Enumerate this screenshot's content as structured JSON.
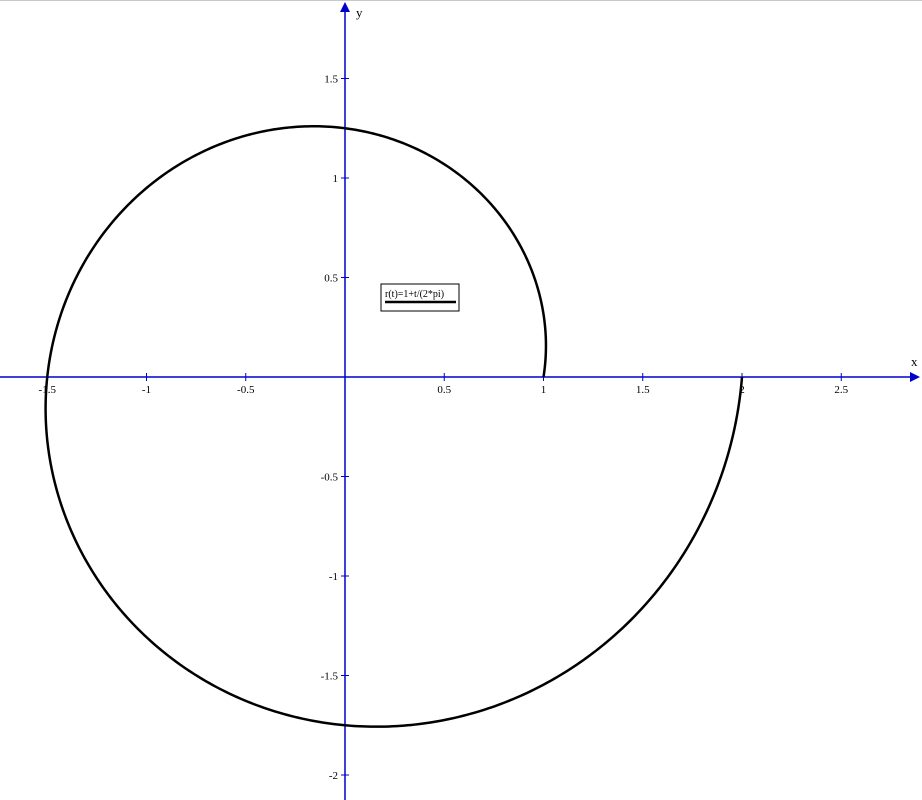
{
  "chart_data": {
    "type": "line",
    "plot_kind": "polar",
    "equation": "r(t)=1+t/(2*pi)",
    "t_range": [
      0,
      6.283185307179586
    ],
    "xlabel": "x",
    "ylabel": "y",
    "xlim": [
      -1.73,
      2.9
    ],
    "ylim": [
      -2.12,
      1.9
    ],
    "x_ticks": [
      {
        "value": -1.5,
        "label": "-1.5"
      },
      {
        "value": -1,
        "label": "-1"
      },
      {
        "value": -0.5,
        "label": "-0.5"
      },
      {
        "value": 0.5,
        "label": "0.5"
      },
      {
        "value": 1,
        "label": "1"
      },
      {
        "value": 1.5,
        "label": "1.5"
      },
      {
        "value": 2,
        "label": "2"
      },
      {
        "value": 2.5,
        "label": "2.5"
      }
    ],
    "y_ticks": [
      {
        "value": 1.5,
        "label": "1.5"
      },
      {
        "value": 1,
        "label": "1"
      },
      {
        "value": 0.5,
        "label": "0.5"
      },
      {
        "value": -0.5,
        "label": "-0.5"
      },
      {
        "value": -1,
        "label": "-1"
      },
      {
        "value": -1.5,
        "label": "-1.5"
      },
      {
        "value": -2,
        "label": "-2"
      }
    ],
    "legend": {
      "label": "r(t)=1+t/(2*pi)"
    },
    "grid": false,
    "colors": {
      "axes": "#0000cc",
      "curve": "#000000",
      "legend_border": "#000000"
    }
  }
}
